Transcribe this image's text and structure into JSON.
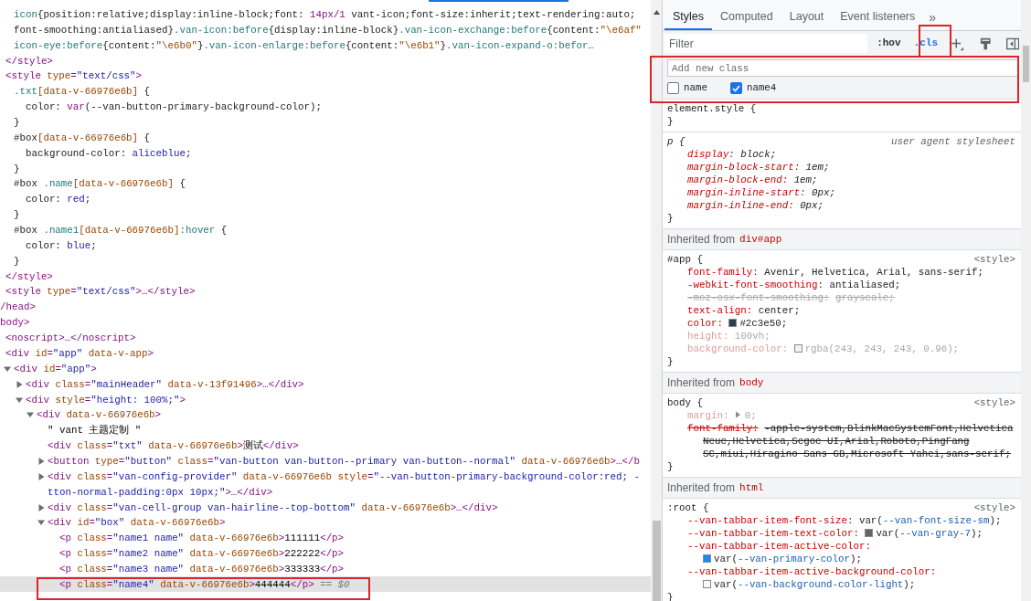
{
  "dom": [
    {
      "closing": [
        {
          "kind": "tag",
          "text": "/head>"
        }
      ],
      "children": [
        {
          "closing": [
            {
              "kind": "tag",
              "text": "</style>"
            }
          ],
          "children": [
            {
              "parts": [
                {
                  "kind": "selector",
                  "text": "icon"
                },
                {
                  "kind": "plain",
                  "text": "{position:relative;display:inline-block;font: "
                },
                {
                  "kind": "keyword",
                  "text": "14px/1"
                },
                {
                  "kind": "plain",
                  "text": " vant-icon;font-size:inherit;text-rendering:auto;"
                }
              ]
            },
            {
              "parts": [
                {
                  "kind": "plain",
                  "text": "font-smoothing:antialiased}"
                },
                {
                  "kind": "selector",
                  "text": ".van-icon:before"
                },
                {
                  "kind": "plain",
                  "text": "{display:inline-block}"
                },
                {
                  "kind": "selector",
                  "text": ".van-icon-exchange:before"
                },
                {
                  "kind": "plain",
                  "text": "{content:"
                },
                {
                  "kind": "attr",
                  "text": "\"\\e6af\""
                }
              ]
            },
            {
              "parts": [
                {
                  "kind": "selector",
                  "text": "icon-eye:before"
                },
                {
                  "kind": "plain",
                  "text": "{content:"
                },
                {
                  "kind": "attr",
                  "text": "\"\\e6b0\""
                },
                {
                  "kind": "plain",
                  "text": "}"
                },
                {
                  "kind": "selector",
                  "text": ".van-icon-enlarge:before"
                },
                {
                  "kind": "plain",
                  "text": "{content:"
                },
                {
                  "kind": "attr",
                  "text": "\"\\e6b1\""
                },
                {
                  "kind": "plain",
                  "text": "}"
                },
                {
                  "kind": "selector",
                  "text": ".van-icon-expand-o:befor…"
                }
              ]
            }
          ]
        },
        {
          "selected": false,
          "parts": [
            {
              "kind": "tag",
              "text": "<style"
            },
            {
              "kind": "attr",
              "text": " type"
            },
            {
              "kind": "tag",
              "text": "="
            },
            {
              "kind": "value",
              "text": "\"text/css\""
            },
            {
              "kind": "tag",
              "text": ">"
            }
          ],
          "closing": [
            {
              "kind": "tag",
              "text": "</style>"
            }
          ],
          "children": [
            {
              "parts": [
                {
                  "kind": "selector",
                  "text": ".txt"
                },
                {
                  "kind": "attr",
                  "text": "[data-v-66976e6b]"
                },
                {
                  "kind": "plain",
                  "text": " {"
                }
              ]
            },
            {
              "parts": [
                {
                  "kind": "plain",
                  "text": "  color: "
                },
                {
                  "kind": "keyword",
                  "text": "var"
                },
                {
                  "kind": "plain",
                  "text": "(--van-button-primary-background-color);"
                }
              ]
            },
            {
              "parts": [
                {
                  "kind": "plain",
                  "text": "}"
                }
              ]
            },
            {
              "parts": [
                {
                  "kind": "plain",
                  "text": "#box"
                },
                {
                  "kind": "attr",
                  "text": "[data-v-66976e6b]"
                },
                {
                  "kind": "plain",
                  "text": " {"
                }
              ]
            },
            {
              "parts": [
                {
                  "kind": "plain",
                  "text": "  background-color: "
                },
                {
                  "kind": "value",
                  "text": "aliceblue"
                },
                {
                  "kind": "plain",
                  "text": ";"
                }
              ]
            },
            {
              "parts": [
                {
                  "kind": "plain",
                  "text": "}"
                }
              ]
            },
            {
              "parts": [
                {
                  "kind": "plain",
                  "text": "#box "
                },
                {
                  "kind": "selector",
                  "text": ".name"
                },
                {
                  "kind": "attr",
                  "text": "[data-v-66976e6b]"
                },
                {
                  "kind": "plain",
                  "text": " {"
                }
              ]
            },
            {
              "parts": [
                {
                  "kind": "plain",
                  "text": "  color: "
                },
                {
                  "kind": "value",
                  "text": "red"
                },
                {
                  "kind": "plain",
                  "text": ";"
                }
              ]
            },
            {
              "parts": [
                {
                  "kind": "plain",
                  "text": "}"
                }
              ]
            },
            {
              "parts": [
                {
                  "kind": "plain",
                  "text": "#box "
                },
                {
                  "kind": "selector",
                  "text": ".name1"
                },
                {
                  "kind": "attr",
                  "text": "[data-v-66976e6b]"
                },
                {
                  "kind": "selector",
                  "text": ":hover"
                },
                {
                  "kind": "plain",
                  "text": " {"
                }
              ]
            },
            {
              "parts": [
                {
                  "kind": "plain",
                  "text": "  color: "
                },
                {
                  "kind": "value",
                  "text": "blue"
                },
                {
                  "kind": "plain",
                  "text": ";"
                }
              ]
            },
            {
              "parts": [
                {
                  "kind": "plain",
                  "text": "}"
                }
              ]
            }
          ]
        },
        {
          "selected": false,
          "parts": [
            {
              "kind": "tag",
              "text": "<style"
            },
            {
              "kind": "attr",
              "text": " type"
            },
            {
              "kind": "tag",
              "text": "="
            },
            {
              "kind": "value",
              "text": "\"text/css\""
            },
            {
              "kind": "tag",
              "text": ">…</style>"
            }
          ]
        }
      ]
    },
    {
      "selected": false,
      "parts": [
        {
          "kind": "tag",
          "text": "body>"
        }
      ],
      "children": [
        {
          "selected": false,
          "parts": [
            {
              "kind": "tag",
              "text": "<noscript>…</noscript>"
            }
          ]
        },
        {
          "selected": false,
          "parts": [
            {
              "kind": "tag",
              "text": "<div"
            },
            {
              "kind": "attr",
              "text": " id"
            },
            {
              "kind": "tag",
              "text": "="
            },
            {
              "kind": "value",
              "text": "\"app\""
            },
            {
              "kind": "attr",
              "text": " data-v-app"
            },
            {
              "kind": "tag",
              "text": ">"
            }
          ],
          "children": [
            {
              "selected": false,
              "expanded": true,
              "parts": [
                {
                  "kind": "tag",
                  "text": "<div"
                },
                {
                  "kind": "attr",
                  "text": " id"
                },
                {
                  "kind": "tag",
                  "text": "="
                },
                {
                  "kind": "value",
                  "text": "\"app\""
                },
                {
                  "kind": "tag",
                  "text": ">"
                }
              ],
              "children": [
                {
                  "selected": false,
                  "expanded": false,
                  "parts": [
                    {
                      "kind": "tag",
                      "text": "<div"
                    },
                    {
                      "kind": "attr",
                      "text": " class"
                    },
                    {
                      "kind": "tag",
                      "text": "="
                    },
                    {
                      "kind": "value",
                      "text": "\"mainHeader\""
                    },
                    {
                      "kind": "attr",
                      "text": " data-v-13f91496"
                    },
                    {
                      "kind": "tag",
                      "text": ">…</div>"
                    }
                  ]
                },
                {
                  "selected": false,
                  "expanded": true,
                  "parts": [
                    {
                      "kind": "tag",
                      "text": "<div"
                    },
                    {
                      "kind": "attr",
                      "text": " style"
                    },
                    {
                      "kind": "tag",
                      "text": "="
                    },
                    {
                      "kind": "value",
                      "text": "\"height: 100%;\""
                    },
                    {
                      "kind": "tag",
                      "text": ">"
                    }
                  ],
                  "children": [
                    {
                      "selected": false,
                      "expanded": true,
                      "parts": [
                        {
                          "kind": "tag",
                          "text": "<div"
                        },
                        {
                          "kind": "attr",
                          "text": " data-v-66976e6b"
                        },
                        {
                          "kind": "tag",
                          "text": ">"
                        }
                      ],
                      "children": [
                        {
                          "selected": false,
                          "parts": [
                            {
                              "kind": "text",
                              "text": "\" vant 主题定制 \""
                            }
                          ]
                        },
                        {
                          "selected": false,
                          "parts": [
                            {
                              "kind": "tag",
                              "text": "<div"
                            },
                            {
                              "kind": "attr",
                              "text": " class"
                            },
                            {
                              "kind": "tag",
                              "text": "="
                            },
                            {
                              "kind": "value",
                              "text": "\"txt\""
                            },
                            {
                              "kind": "attr",
                              "text": " data-v-66976e6b"
                            },
                            {
                              "kind": "tag",
                              "text": ">"
                            },
                            {
                              "kind": "text",
                              "text": "测试"
                            },
                            {
                              "kind": "tag",
                              "text": "</div>"
                            }
                          ]
                        },
                        {
                          "selected": false,
                          "expanded": false,
                          "parts": [
                            {
                              "kind": "tag",
                              "text": "<button"
                            },
                            {
                              "kind": "attr",
                              "text": " type"
                            },
                            {
                              "kind": "tag",
                              "text": "="
                            },
                            {
                              "kind": "value",
                              "text": "\"button\""
                            },
                            {
                              "kind": "attr",
                              "text": " class"
                            },
                            {
                              "kind": "tag",
                              "text": "="
                            },
                            {
                              "kind": "value",
                              "text": "\"van-button van-button--primary van-button--normal\""
                            },
                            {
                              "kind": "attr",
                              "text": " data-v-66976e6b"
                            },
                            {
                              "kind": "tag",
                              "text": ">…</b"
                            }
                          ]
                        },
                        {
                          "selected": false,
                          "expanded": false,
                          "parts": [
                            {
                              "kind": "tag",
                              "text": "<div"
                            },
                            {
                              "kind": "attr",
                              "text": " class"
                            },
                            {
                              "kind": "tag",
                              "text": "="
                            },
                            {
                              "kind": "value",
                              "text": "\"van-config-provider\""
                            },
                            {
                              "kind": "attr",
                              "text": " data-v-66976e6b"
                            },
                            {
                              "kind": "attr",
                              "text": " style"
                            },
                            {
                              "kind": "tag",
                              "text": "="
                            },
                            {
                              "kind": "value",
                              "text": "\"--van-button-primary-background-color:red; -"
                            }
                          ],
                          "wrapped": [
                            {
                              "kind": "value",
                              "text": "tton-normal-padding:0px 10px;\""
                            },
                            {
                              "kind": "tag",
                              "text": ">…</div>"
                            }
                          ]
                        },
                        {
                          "selected": false,
                          "expanded": false,
                          "parts": [
                            {
                              "kind": "tag",
                              "text": "<div"
                            },
                            {
                              "kind": "attr",
                              "text": " class"
                            },
                            {
                              "kind": "tag",
                              "text": "="
                            },
                            {
                              "kind": "value",
                              "text": "\"van-cell-group van-hairline--top-bottom\""
                            },
                            {
                              "kind": "attr",
                              "text": " data-v-66976e6b"
                            },
                            {
                              "kind": "tag",
                              "text": ">…</div>"
                            }
                          ]
                        },
                        {
                          "selected": false,
                          "expanded": true,
                          "parts": [
                            {
                              "kind": "tag",
                              "text": "<div"
                            },
                            {
                              "kind": "attr",
                              "text": " id"
                            },
                            {
                              "kind": "tag",
                              "text": "="
                            },
                            {
                              "kind": "value",
                              "text": "\"box\""
                            },
                            {
                              "kind": "attr",
                              "text": " data-v-66976e6b"
                            },
                            {
                              "kind": "tag",
                              "text": ">"
                            }
                          ],
                          "children": [
                            {
                              "selected": false,
                              "parts": [
                                {
                                  "kind": "tag",
                                  "text": "<p"
                                },
                                {
                                  "kind": "attr",
                                  "text": " class"
                                },
                                {
                                  "kind": "tag",
                                  "text": "="
                                },
                                {
                                  "kind": "value",
                                  "text": "\"name1 name\""
                                },
                                {
                                  "kind": "attr",
                                  "text": " data-v-66976e6b"
                                },
                                {
                                  "kind": "tag",
                                  "text": ">"
                                },
                                {
                                  "kind": "text",
                                  "text": "111111"
                                },
                                {
                                  "kind": "tag",
                                  "text": "</p>"
                                }
                              ]
                            },
                            {
                              "selected": false,
                              "parts": [
                                {
                                  "kind": "tag",
                                  "text": "<p"
                                },
                                {
                                  "kind": "attr",
                                  "text": " class"
                                },
                                {
                                  "kind": "tag",
                                  "text": "="
                                },
                                {
                                  "kind": "value",
                                  "text": "\"name2 name\""
                                },
                                {
                                  "kind": "attr",
                                  "text": " data-v-66976e6b"
                                },
                                {
                                  "kind": "tag",
                                  "text": ">"
                                },
                                {
                                  "kind": "text",
                                  "text": "222222"
                                },
                                {
                                  "kind": "tag",
                                  "text": "</p>"
                                }
                              ]
                            },
                            {
                              "selected": false,
                              "parts": [
                                {
                                  "kind": "tag",
                                  "text": "<p"
                                },
                                {
                                  "kind": "attr",
                                  "text": " class"
                                },
                                {
                                  "kind": "tag",
                                  "text": "="
                                },
                                {
                                  "kind": "value",
                                  "text": "\"name3 name\""
                                },
                                {
                                  "kind": "attr",
                                  "text": " data-v-66976e6b"
                                },
                                {
                                  "kind": "tag",
                                  "text": ">"
                                },
                                {
                                  "kind": "text",
                                  "text": "333333"
                                },
                                {
                                  "kind": "tag",
                                  "text": "</p>"
                                }
                              ]
                            },
                            {
                              "selected": true,
                              "parts": [
                                {
                                  "kind": "tag",
                                  "text": "<p"
                                },
                                {
                                  "kind": "attr",
                                  "text": " class"
                                },
                                {
                                  "kind": "tag",
                                  "text": "="
                                },
                                {
                                  "kind": "value",
                                  "text": "\"name4\""
                                },
                                {
                                  "kind": "attr",
                                  "text": " data-v-66976e6b"
                                },
                                {
                                  "kind": "tag",
                                  "text": ">"
                                },
                                {
                                  "kind": "text",
                                  "text": "444444"
                                },
                                {
                                  "kind": "tag",
                                  "text": "</p>"
                                },
                                {
                                  "kind": "note",
                                  "text": " == $0"
                                }
                              ]
                            }
                          ]
                        }
                      ]
                    }
                  ]
                }
              ]
            }
          ]
        }
      ]
    }
  ],
  "styles": {
    "tabs": [
      {
        "label": "Styles",
        "selected": true
      },
      {
        "label": "Computed",
        "selected": false
      },
      {
        "label": "Layout",
        "selected": false
      },
      {
        "label": "Event listeners",
        "selected": false
      }
    ],
    "more": "»",
    "filter": {
      "placeholder": "Filter"
    },
    "hov": {
      "label": ":hov",
      "selected": false
    },
    "cls": {
      "label": ".cls",
      "selected": true
    },
    "class_editor": {
      "placeholder": "Add new class",
      "classes": [
        {
          "name": "name",
          "checked": false
        },
        {
          "name": "name4",
          "checked": true
        }
      ]
    },
    "sections": [
      {
        "kind": "rule",
        "selector": "element.style {",
        "user_agent": false,
        "close": "}"
      },
      {
        "kind": "rule",
        "selector": "p {",
        "source": "user agent stylesheet",
        "user_agent": true,
        "close": "}",
        "declarations": [
          {
            "property": "display:",
            "kind": "active",
            "value": [
              {
                "kind": "plain",
                "text": "block;"
              }
            ]
          },
          {
            "property": "margin-block-start:",
            "kind": "active",
            "value": [
              {
                "kind": "plain",
                "text": "1em;"
              }
            ]
          },
          {
            "property": "margin-block-end:",
            "kind": "active",
            "value": [
              {
                "kind": "plain",
                "text": "1em;"
              }
            ]
          },
          {
            "property": "margin-inline-start:",
            "kind": "active",
            "value": [
              {
                "kind": "plain",
                "text": "0px;"
              }
            ]
          },
          {
            "property": "margin-inline-end:",
            "kind": "active",
            "value": [
              {
                "kind": "plain",
                "text": "0px;"
              }
            ]
          }
        ]
      },
      {
        "kind": "inherited",
        "label": "Inherited from",
        "element": "div#app"
      },
      {
        "kind": "rule",
        "selector": "#app {",
        "source": "<style>",
        "user_agent": false,
        "close": "}",
        "declarations": [
          {
            "property": "font-family:",
            "kind": "active",
            "value": [
              {
                "kind": "plain",
                "text": "Avenir, Helvetica, Arial, sans-serif;"
              }
            ]
          },
          {
            "property": "-webkit-font-smoothing:",
            "kind": "active",
            "value": [
              {
                "kind": "plain",
                "text": "antialiased;"
              }
            ]
          },
          {
            "property": "-moz-osx-font-smoothing:",
            "kind": "invalid",
            "value": [
              {
                "kind": "plain",
                "text": "grayscale;"
              }
            ]
          },
          {
            "property": "text-align:",
            "kind": "active",
            "value": [
              {
                "kind": "plain",
                "text": "center;"
              }
            ]
          },
          {
            "property": "color:",
            "kind": "active",
            "value": [
              {
                "kind": "swatch",
                "color": "#2c3e50"
              },
              {
                "kind": "plain",
                "text": "#2c3e50;"
              }
            ]
          },
          {
            "property": "height:",
            "kind": "inactive",
            "value": [
              {
                "kind": "plain",
                "text": "100vh;"
              }
            ]
          },
          {
            "property": "background-color:",
            "kind": "inactive",
            "value": [
              {
                "kind": "swatch",
                "color": "#f3f3f3"
              },
              {
                "kind": "plain",
                "text": "rgba(243, 243, 243, 0.96);"
              }
            ]
          }
        ]
      },
      {
        "kind": "inherited",
        "label": "Inherited from",
        "element": "body"
      },
      {
        "kind": "rule",
        "selector": "body {",
        "source": "<style>",
        "user_agent": false,
        "close": "}",
        "declarations": [
          {
            "property": "margin:",
            "kind": "inactive",
            "value": [
              {
                "kind": "expander"
              },
              {
                "kind": "plain",
                "text": "0;"
              }
            ]
          },
          {
            "property": "font-family:",
            "kind": "overridden",
            "value": [
              {
                "kind": "plain",
                "text": "-apple-system,BlinkMacSystemFont,Helvetica"
              },
              {
                "kind": "continuation",
                "text": "Neue,Helvetica,Segoe UI,Arial,Roboto,PingFang"
              },
              {
                "kind": "continuation",
                "text": "SC,miui,Hiragino Sans GB,Microsoft Yahei,sans-serif;"
              }
            ]
          }
        ]
      },
      {
        "kind": "inherited",
        "label": "Inherited from",
        "element": "html"
      },
      {
        "kind": "rule",
        "selector": ":root {",
        "source": "<style>",
        "user_agent": false,
        "close": "}",
        "declarations": [
          {
            "property": "--van-tabbar-item-font-size:",
            "kind": "active",
            "value": [
              {
                "kind": "plain",
                "text": "var("
              },
              {
                "kind": "link",
                "text": "--van-font-size-sm"
              },
              {
                "kind": "plain",
                "text": ");"
              }
            ]
          },
          {
            "property": "--van-tabbar-item-text-color:",
            "kind": "active",
            "value": [
              {
                "kind": "swatch",
                "color": "#646566"
              },
              {
                "kind": "plain",
                "text": "var("
              },
              {
                "kind": "link",
                "text": "--van-gray-7"
              },
              {
                "kind": "plain",
                "text": ");"
              }
            ]
          },
          {
            "property": "--van-tabbar-item-active-color:",
            "kind": "active",
            "value": [
              {
                "kind": "swatch",
                "color": "#1989fa"
              },
              {
                "kind": "plain",
                "text": "var("
              },
              {
                "kind": "link",
                "text": "--van-primary-color"
              },
              {
                "kind": "plain",
                "text": ");"
              }
            ]
          },
          {
            "property": "--van-tabbar-item-active-background-color:",
            "kind": "active",
            "value": [
              {
                "kind": "swatch",
                "color": "#fafafa"
              },
              {
                "kind": "plain",
                "text": "var("
              },
              {
                "kind": "link",
                "text": "--van-background-color-light"
              },
              {
                "kind": "plain",
                "text": ");"
              }
            ]
          }
        ]
      }
    ]
  }
}
